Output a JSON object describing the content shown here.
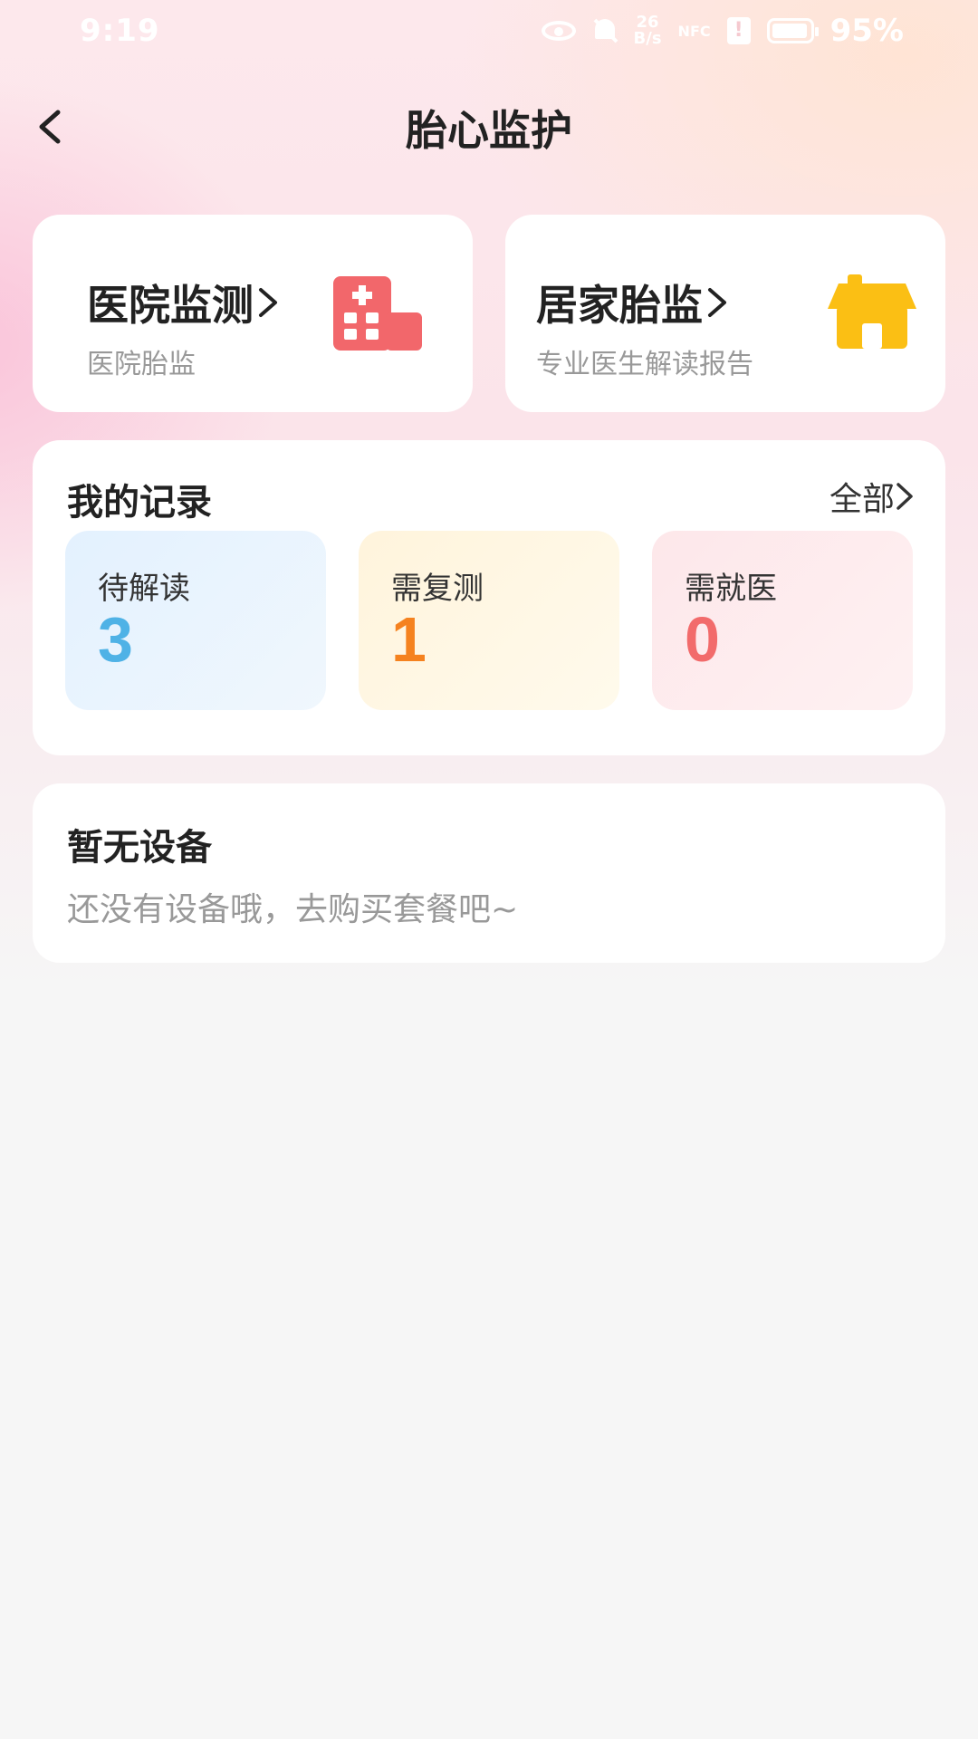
{
  "status_bar": {
    "time": "9:19",
    "net_speed_top": "26",
    "net_speed_bottom": "B/s",
    "nfc": "NFC",
    "battery": "95%",
    "icons": [
      "eye-icon",
      "bell-off-icon",
      "nfc-icon",
      "alert-icon",
      "battery-icon"
    ]
  },
  "header": {
    "title": "胎心监护",
    "back_icon": "chevron-left-icon"
  },
  "modes": [
    {
      "title": "医院监测",
      "subtitle": "医院胎监",
      "icon": "hospital-icon",
      "icon_color": "#f2676b"
    },
    {
      "title": "居家胎监",
      "subtitle": "专业医生解读报告",
      "icon": "house-icon",
      "icon_color": "#fbbf14"
    }
  ],
  "records": {
    "title": "我的记录",
    "all_label": "全部",
    "stats": [
      {
        "label": "待解读",
        "value": "3",
        "color": "#4fb2e6"
      },
      {
        "label": "需复测",
        "value": "1",
        "color": "#f5821f"
      },
      {
        "label": "需就医",
        "value": "0",
        "color": "#f26b6b"
      }
    ]
  },
  "device": {
    "title": "暂无设备",
    "subtitle": "还没有设备哦，去购买套餐吧~"
  }
}
